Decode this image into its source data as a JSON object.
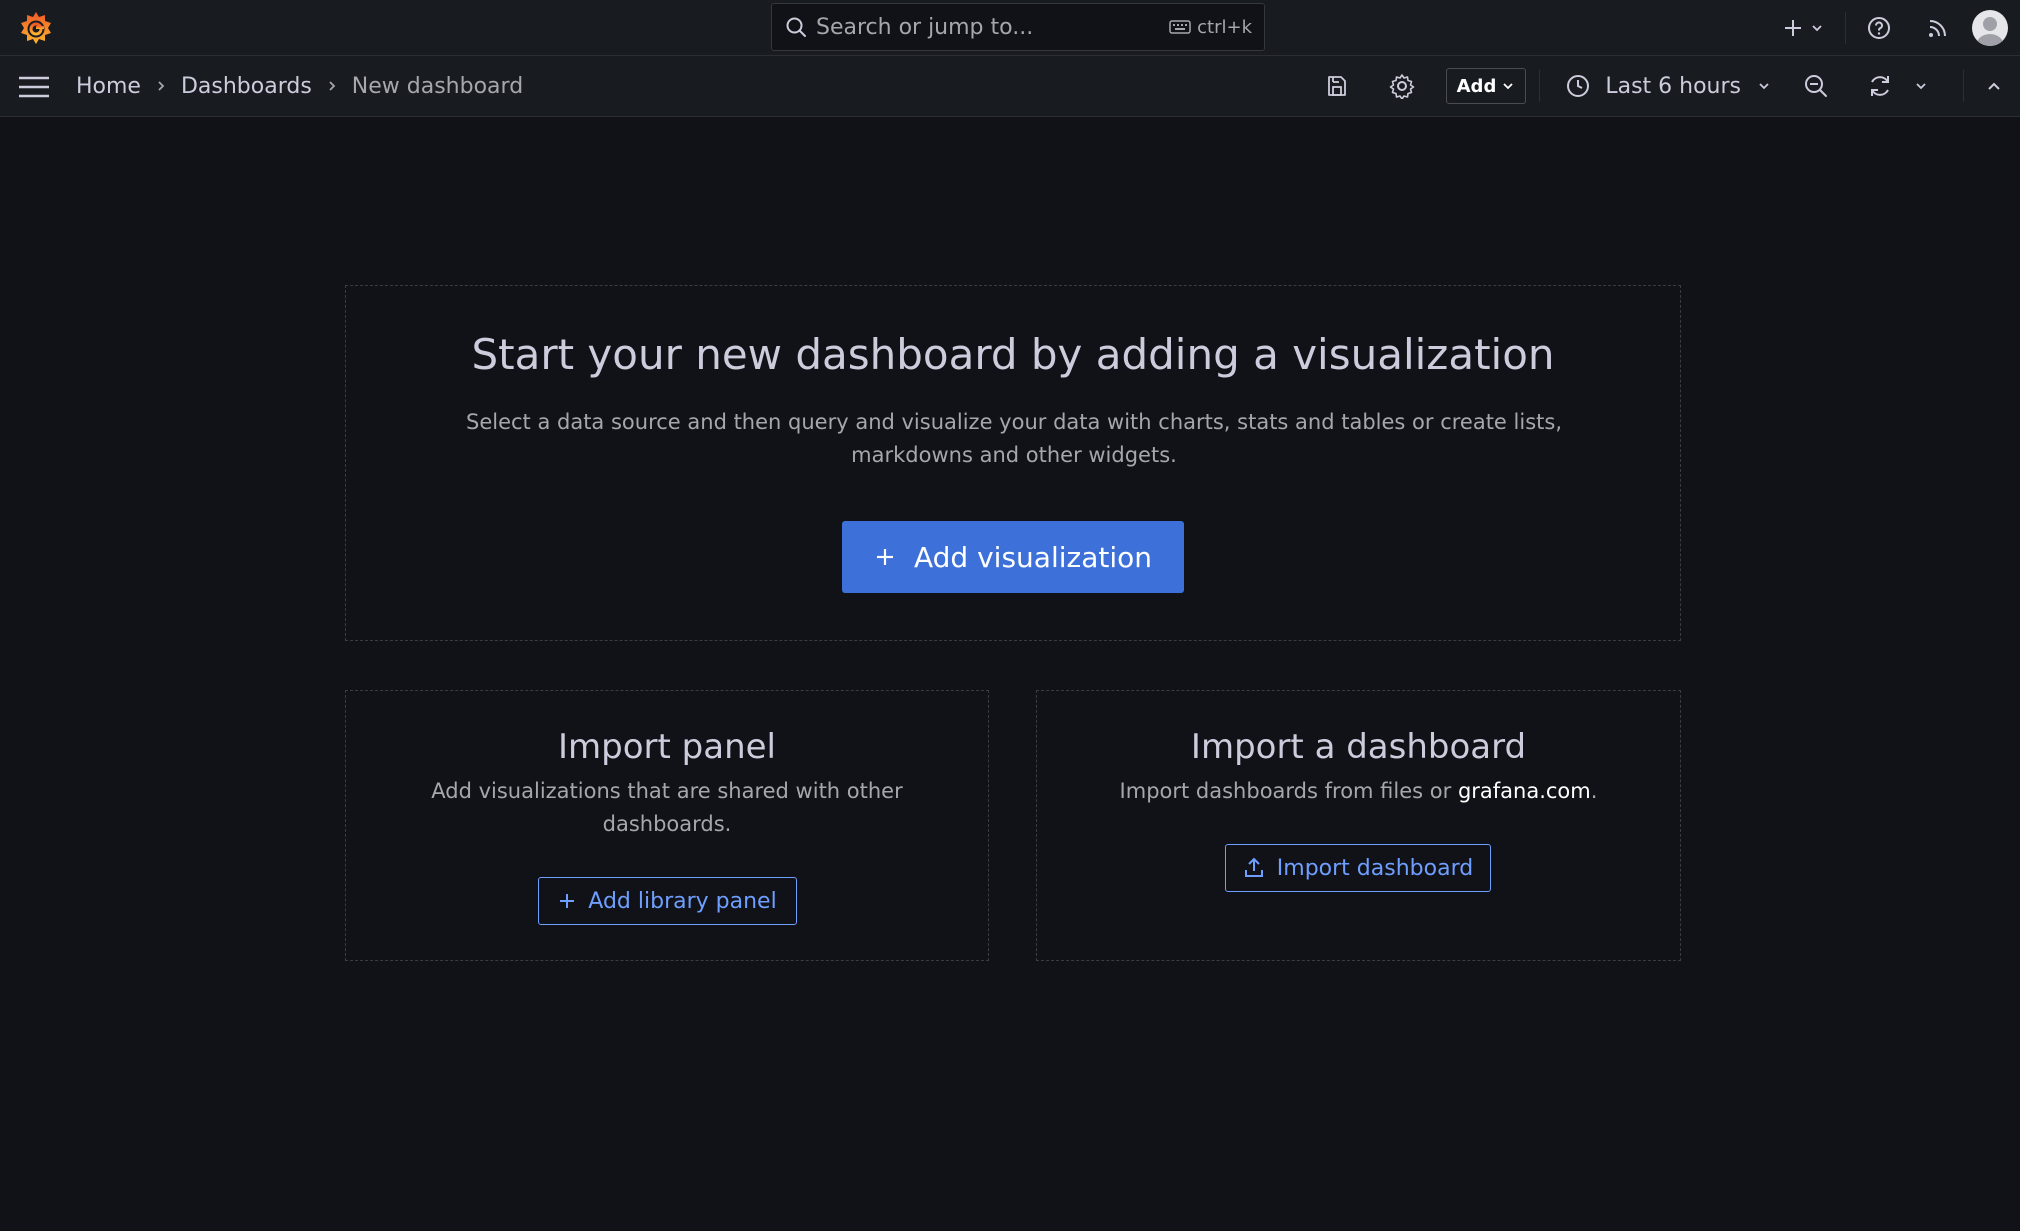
{
  "topbar": {
    "search_placeholder": "Search or jump to...",
    "search_shortcut": "ctrl+k"
  },
  "breadcrumb": {
    "items": [
      "Home",
      "Dashboards",
      "New dashboard"
    ]
  },
  "toolbar": {
    "add_label": "Add",
    "time_range": "Last 6 hours"
  },
  "main": {
    "title": "Start your new dashboard by adding a visualization",
    "description": "Select a data source and then query and visualize your data with charts, stats and tables or create lists, markdowns and other widgets.",
    "add_visualization_label": "Add visualization"
  },
  "import_panel": {
    "title": "Import panel",
    "description": "Add visualizations that are shared with other dashboards.",
    "button_label": "Add library panel"
  },
  "import_dashboard": {
    "title": "Import a dashboard",
    "description_prefix": "Import dashboards from files or ",
    "link_text": "grafana.com",
    "description_suffix": ".",
    "button_label": "Import dashboard"
  },
  "colors": {
    "background": "#111217",
    "header": "#181b1f",
    "primary": "#3d71d9",
    "link": "#6e9fff",
    "logo": "#f46800"
  }
}
